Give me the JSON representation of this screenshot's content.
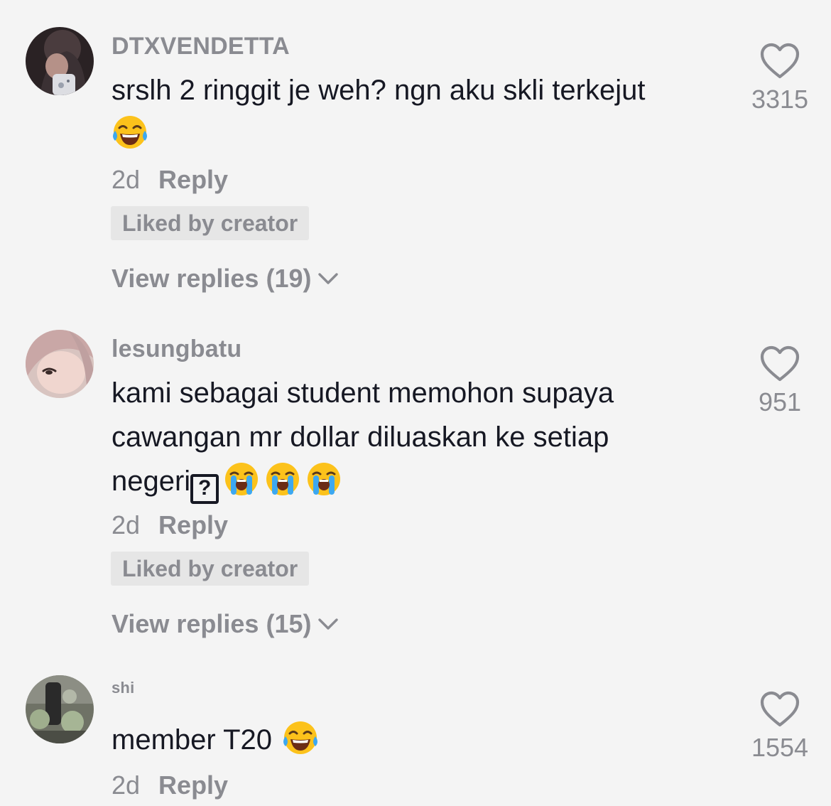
{
  "comments": [
    {
      "username": "DTXVENDETTA",
      "text_line1": "srslh 2 ringgit je weh? ngn aku skli terkejut",
      "time": "2d",
      "reply": "Reply",
      "liked_badge": "Liked by creator",
      "view_replies": "View replies (19)",
      "likes": "3315",
      "emoji": [
        "face-with-tears-of-joy"
      ]
    },
    {
      "username": "lesungbatu",
      "text_line1": "kami sebagai student memohon supaya",
      "text_line2": "cawangan mr dollar diluaskan ke setiap",
      "text_line3": "negeri",
      "unknown_glyph": "?",
      "time": "2d",
      "reply": "Reply",
      "liked_badge": "Liked by creator",
      "view_replies": "View replies (15)",
      "likes": "951",
      "emoji": [
        "loudly-crying-face",
        "loudly-crying-face",
        "loudly-crying-face"
      ]
    },
    {
      "username": "shi",
      "text_line1": "member T20",
      "time": "2d",
      "reply": "Reply",
      "likes": "1554",
      "emoji": [
        "face-with-tears-of-joy"
      ]
    }
  ],
  "colors": {
    "background": "#f4f4f4",
    "primary_text": "#161823",
    "secondary_text": "#8a8b91",
    "badge_bg": "#e6e6e6"
  }
}
